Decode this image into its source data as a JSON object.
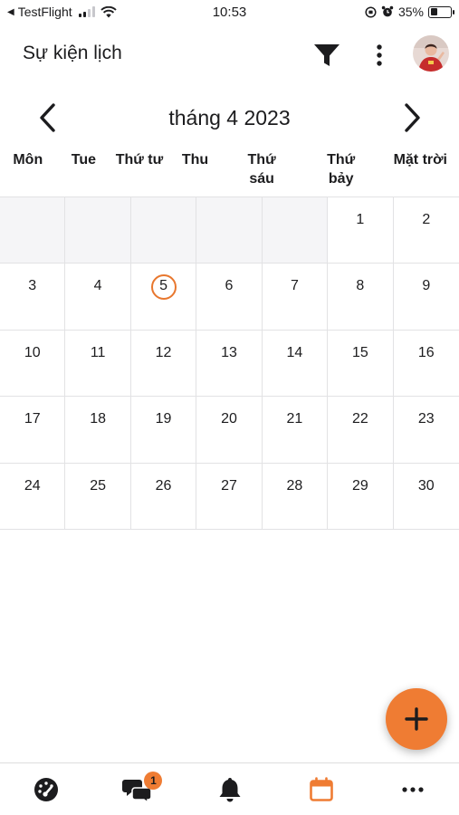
{
  "status_bar": {
    "back_app": "TestFlight",
    "time": "10:53",
    "battery": "35%",
    "battery_level": 0.35
  },
  "header": {
    "title": "Sự kiện lịch"
  },
  "calendar": {
    "month_title": "tháng 4 2023",
    "weekdays": [
      "Môn",
      "Tue",
      "Thứ tư",
      "Thu",
      "Thứ sáu",
      "Thứ bảy",
      "Mặt trời"
    ],
    "days": [
      "",
      "",
      "",
      "",
      "",
      "1",
      "2",
      "3",
      "4",
      "5",
      "6",
      "7",
      "8",
      "9",
      "10",
      "11",
      "12",
      "13",
      "14",
      "15",
      "16",
      "17",
      "18",
      "19",
      "20",
      "21",
      "22",
      "23",
      "24",
      "25",
      "26",
      "27",
      "28",
      "29",
      "30"
    ],
    "today": "5"
  },
  "fab": {
    "icon": "plus-icon"
  },
  "tabbar": {
    "tabs": [
      {
        "icon": "dashboard-icon",
        "active": false
      },
      {
        "icon": "chat-icon",
        "badge": "1",
        "active": false
      },
      {
        "icon": "bell-icon",
        "active": false
      },
      {
        "icon": "calendar-icon",
        "active": true
      },
      {
        "icon": "more-horizontal-icon",
        "active": false
      }
    ]
  },
  "colors": {
    "accent": "#ef7c33",
    "text": "#1c1c1e",
    "grid_line": "#e2e2e4",
    "empty_cell": "#f5f5f7"
  }
}
